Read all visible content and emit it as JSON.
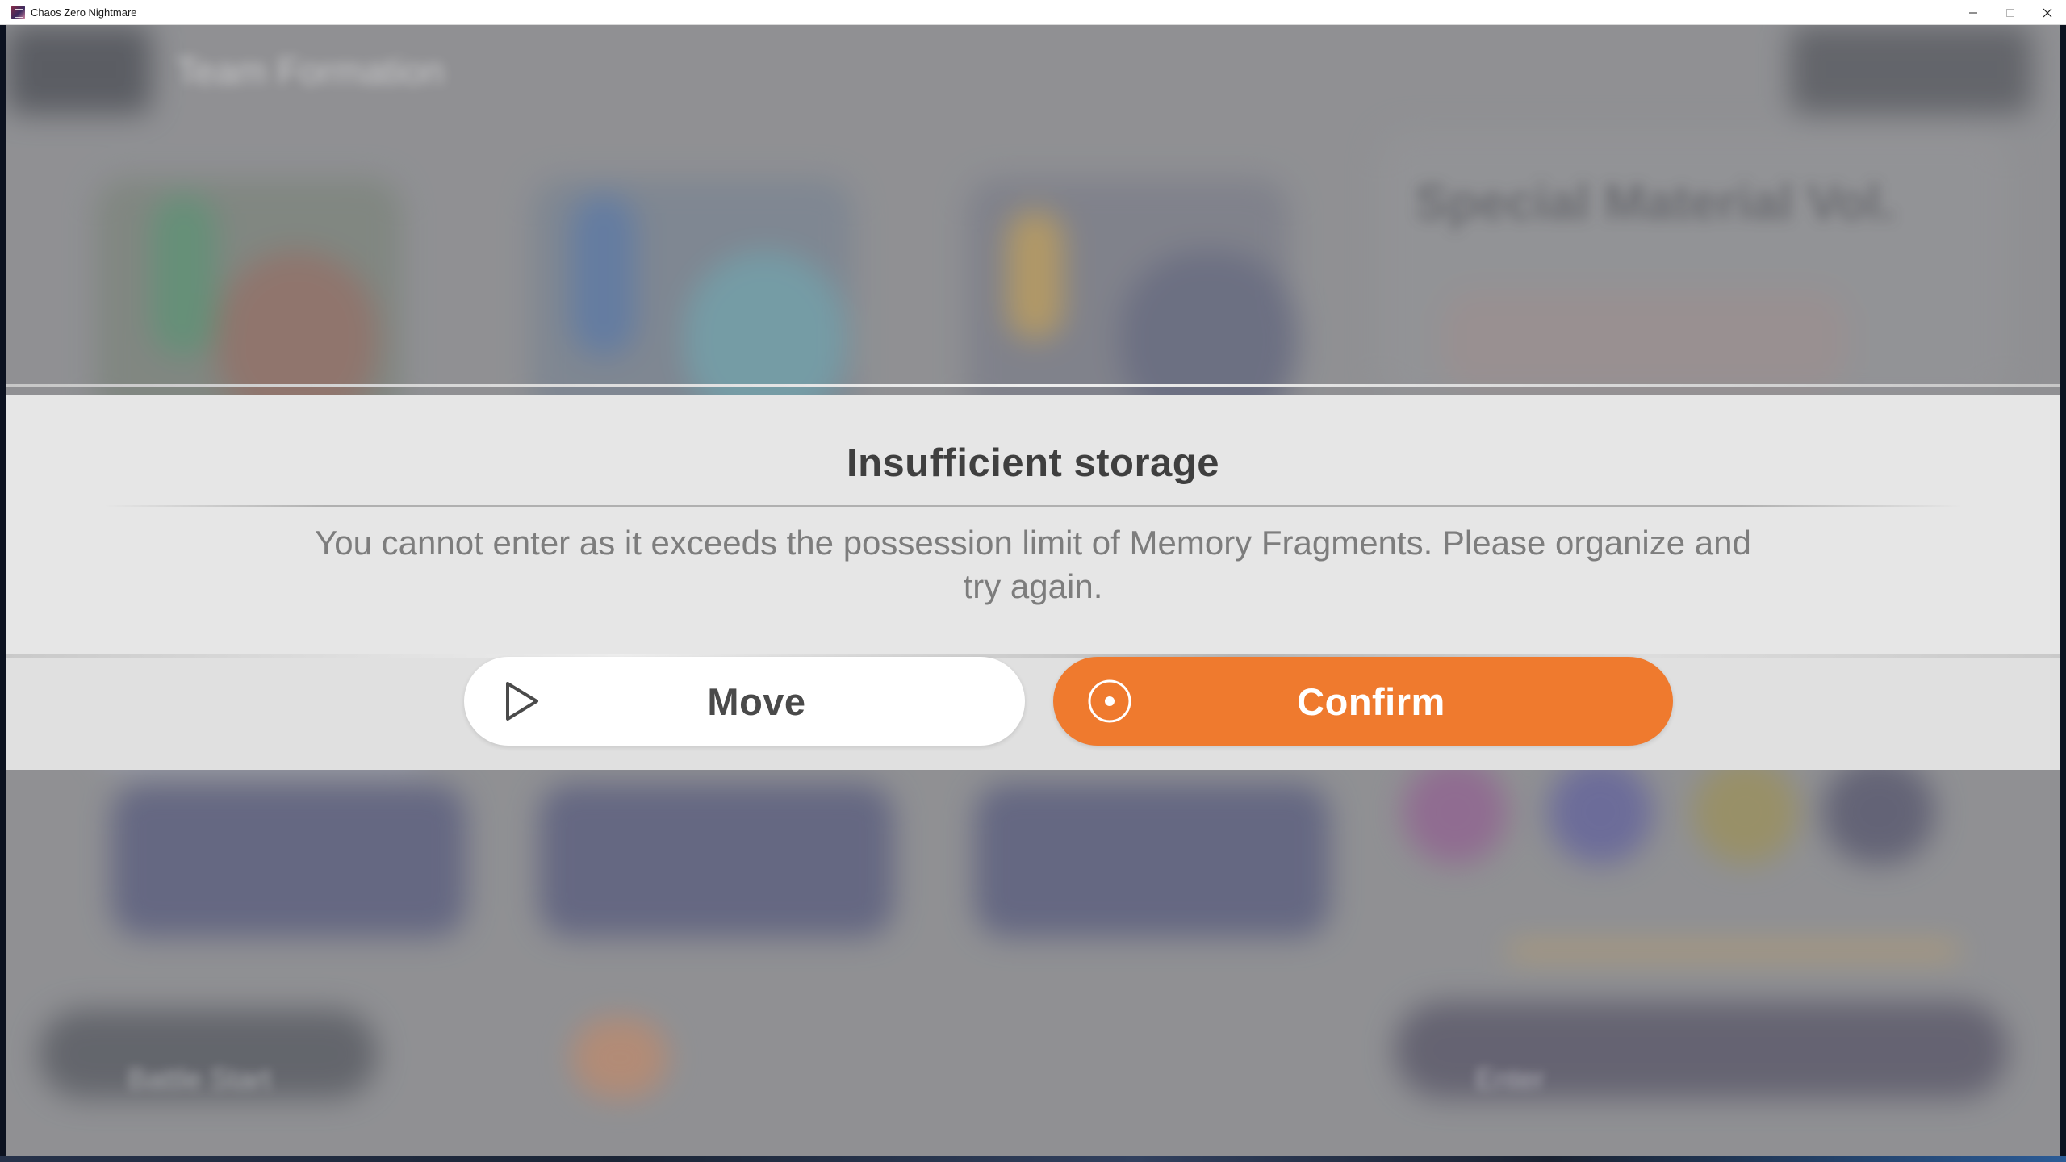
{
  "window": {
    "title": "Chaos Zero Nightmare",
    "controls": {
      "minimize_icon": "minimize-icon",
      "maximize_icon": "maximize-icon",
      "close_icon": "close-icon"
    }
  },
  "background": {
    "screen_title": "Team Formation",
    "right_panel_title": "Special Material Vol.",
    "bottom_left_label": "Battle Start",
    "bottom_right_label": "Enter"
  },
  "dialog": {
    "title": "Insufficient storage",
    "message": "You cannot enter as it exceeds the possession limit of Memory Fragments. Please organize and try again.",
    "buttons": {
      "move": {
        "label": "Move",
        "icon": "play-triangle-icon"
      },
      "confirm": {
        "label": "Confirm",
        "icon": "target-circle-icon"
      }
    },
    "colors": {
      "confirm_bg": "#ef7a2e",
      "move_bg": "#ffffff",
      "panel_bg": "#e6e6e6"
    }
  }
}
